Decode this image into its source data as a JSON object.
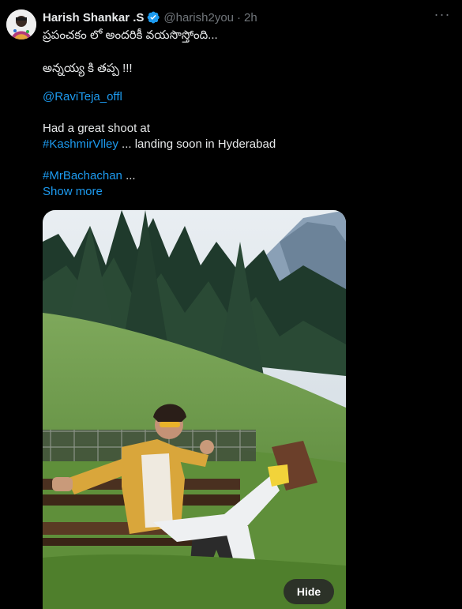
{
  "tweet": {
    "author_name": "Harish Shankar .S",
    "handle": "@harish2you",
    "separator": "·",
    "time": "2h",
    "more_glyph": "···",
    "lines": {
      "line1": "ప్రపంచకం లో  అందరికీ వయసొస్తోంది...",
      "line2": "అన్నయ్య కి తప్ప !!!",
      "mention": "@RaviTeja_offl",
      "line3": "Had a great shoot at",
      "hashtag1": "#KashmirVlley",
      "line4_rest": " ... landing soon in Hyderabad",
      "hashtag2": "#MrBachachan",
      "line5_rest": " ..."
    },
    "show_more": "Show more",
    "media": {
      "hide_label": "Hide"
    }
  },
  "colors": {
    "background": "#000000",
    "text": "#e7e9ea",
    "secondary": "#71767b",
    "link": "#1d9bf0",
    "verified": "#1d9bf0"
  },
  "icons": {
    "verified": "verified-badge-icon",
    "more": "more-horizontal-icon"
  }
}
